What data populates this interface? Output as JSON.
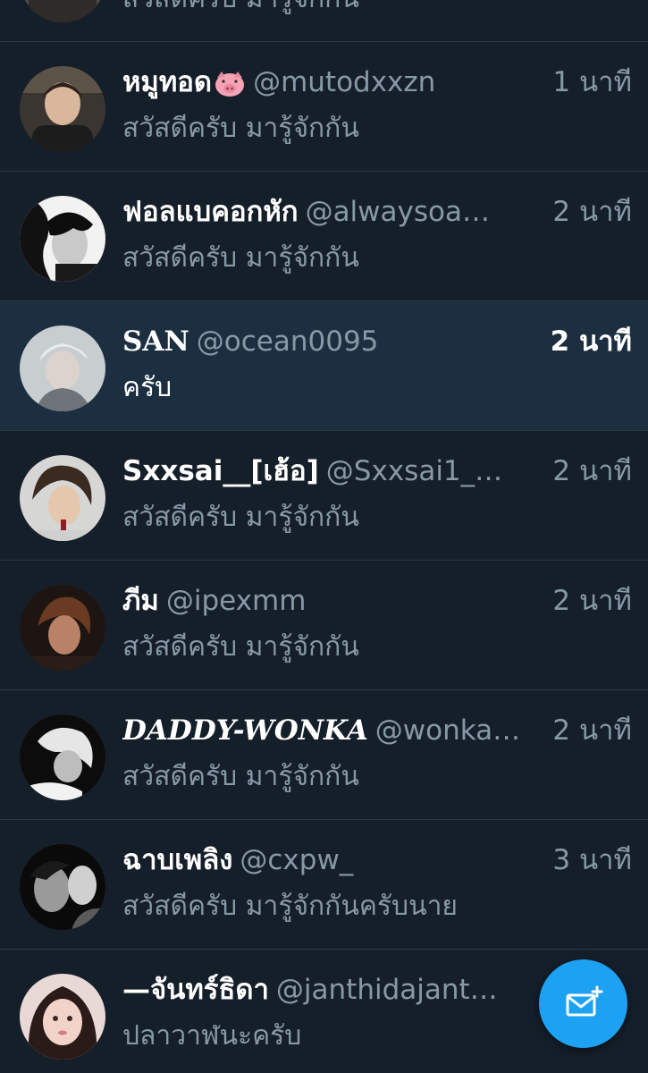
{
  "messages": [
    {
      "name": "",
      "handle": "",
      "time": "",
      "preview": "สวัสดีครับ มารู้จักกัน",
      "unread": false
    },
    {
      "name": "หมูทอด",
      "name_emoji": "pig-face-icon",
      "handle": "@mutodxxzn",
      "time": "1 นาที",
      "preview": "สวัสดีครับ มารู้จักกัน",
      "unread": false
    },
    {
      "name": "ฟอลแบคอกหัก",
      "handle": "@alwaysoa…",
      "time": "2 นาที",
      "preview": "สวัสดีครับ มารู้จักกัน",
      "unread": false
    },
    {
      "name": "SAN",
      "handle": "@ocean0095",
      "time": "2 นาที",
      "preview": "ครับ",
      "unread": true
    },
    {
      "name": "Sxxsai__[เฮ้อ]",
      "handle": "@Sxxsai1_…",
      "time": "2 นาที",
      "preview": "สวัสดีครับ มารู้จักกัน",
      "unread": false
    },
    {
      "name": "ภีม",
      "handle": "@ipexmm",
      "time": "2 นาที",
      "preview": "สวัสดีครับ มารู้จักกัน",
      "unread": false
    },
    {
      "name": "DADDY-WONKA",
      "handle": "@wonka…",
      "time": "2 นาที",
      "preview": "สวัสดีครับ มารู้จักกัน",
      "unread": false
    },
    {
      "name": "ฉาบเพลิง",
      "handle": "@cxpw_",
      "time": "3 นาที",
      "preview": "สวัสดีครับ มารู้จักกันครับนาย",
      "unread": false
    },
    {
      "name": "—จันทร์ธิดา",
      "handle": "@janthidajant…",
      "time": "",
      "preview": "ปลาวาฬนะครับ",
      "unread": false
    }
  ],
  "fab": {
    "icon": "new-message-icon"
  },
  "colors": {
    "background": "#151f2a",
    "unread_background": "#1b2f40",
    "divider": "#2b3845",
    "secondary_text": "#8899a6",
    "primary_text": "#ffffff",
    "accent": "#1da1f2"
  }
}
